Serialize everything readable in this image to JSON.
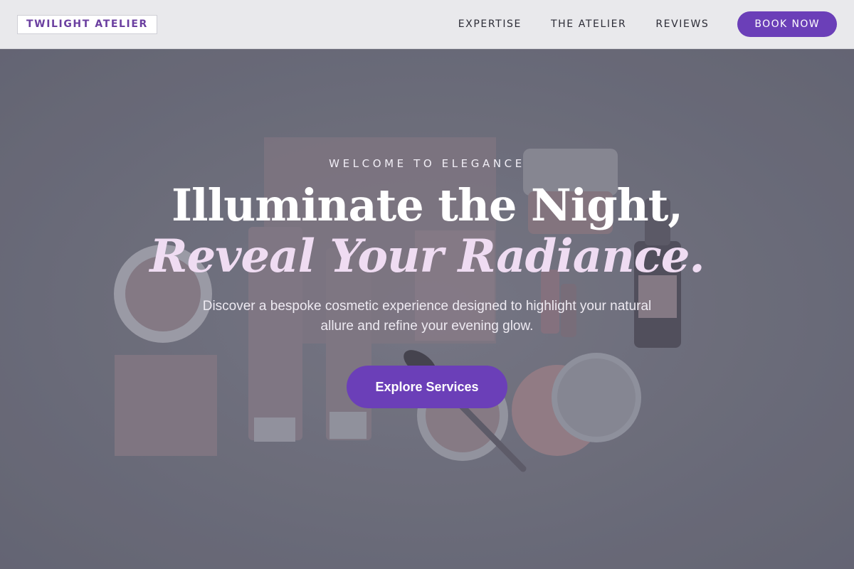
{
  "brand": {
    "logo_text": "TWILIGHT ATELIER"
  },
  "nav": {
    "links": [
      "EXPERTISE",
      "THE ATELIER",
      "REVIEWS"
    ],
    "book_label": "BOOK NOW"
  },
  "hero": {
    "eyebrow": "WELCOME TO ELEGANCE",
    "headline_line1": "Illuminate the Night,",
    "headline_line2": "Reveal Your Radiance.",
    "subtext": "Discover a bespoke cosmetic experience designed to highlight your natural allure and refine your evening glow.",
    "cta_label": "Explore Services"
  },
  "colors": {
    "accent": "#6b3fb8",
    "logo_text": "#6b3fa0",
    "header_bg": "#e9e9ec",
    "hero_overlay": "#6d6e7b",
    "headline_italic": "#efdcf2"
  }
}
